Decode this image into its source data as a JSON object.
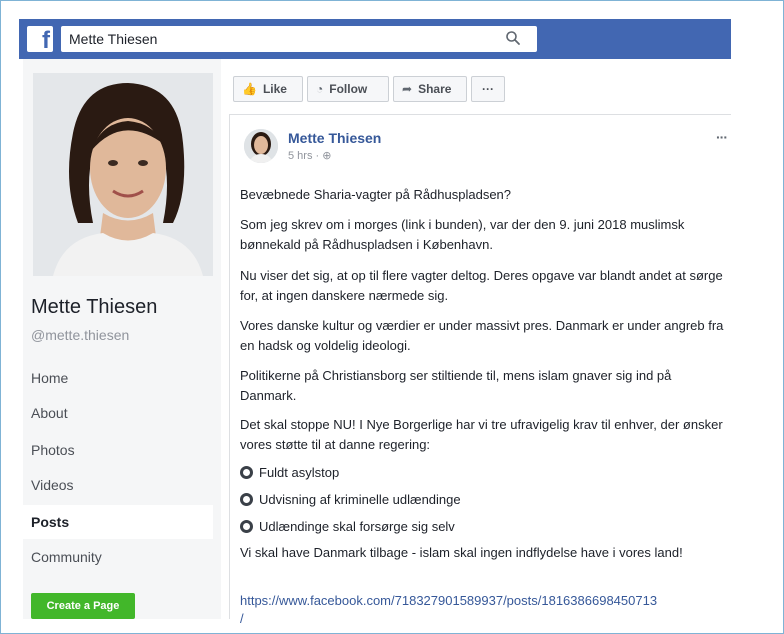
{
  "header": {
    "search_value": "Mette Thiesen"
  },
  "profile": {
    "name": "Mette Thiesen",
    "handle": "@mette.thiesen"
  },
  "nav": {
    "items": [
      "Home",
      "About",
      "Photos",
      "Videos",
      "Posts",
      "Community"
    ],
    "active": "Posts",
    "create_page": "Create a Page"
  },
  "actions": {
    "like": "Like",
    "follow": "Follow",
    "share": "Share",
    "more": "···"
  },
  "post": {
    "author": "Mette Thiesen",
    "time": "5 hrs ·",
    "paragraphs": [
      "Bevæbnede Sharia-vagter på Rådhuspladsen?",
      "Som jeg skrev om i morges (link i bunden), var der den 9. juni 2018 muslimsk bønnekald på Rådhuspladsen i København.",
      "Nu viser det sig, at op til flere vagter deltog. Deres opgave var blandt andet at sørge for, at ingen danskere nærmede sig.",
      "Vores danske kultur og værdier er under massivt pres. Danmark er under angreb fra en hadsk og voldelig ideologi.",
      "Politikerne på Christiansborg ser stiltiende til, mens islam gnaver sig ind på Danmark.",
      "Det skal stoppe NU! I Nye Borgerlige har vi tre ufravigelig krav til enhver, der ønsker vores støtte til at danne regering:"
    ],
    "bullets": [
      "Fuldt asylstop",
      "Udvisning af kriminelle udlændinge",
      "Udlændinge skal forsørge sig selv"
    ],
    "closing": "Vi skal have Danmark tilbage - islam skal ingen indflydelse have i vores land!",
    "link": "https://www.facebook.com/718327901589937/posts/1816386698450713",
    "link_tail": "/"
  },
  "colors": {
    "brand_blue": "#4267b2",
    "link_blue": "#365899",
    "create_green": "#42b72a"
  }
}
